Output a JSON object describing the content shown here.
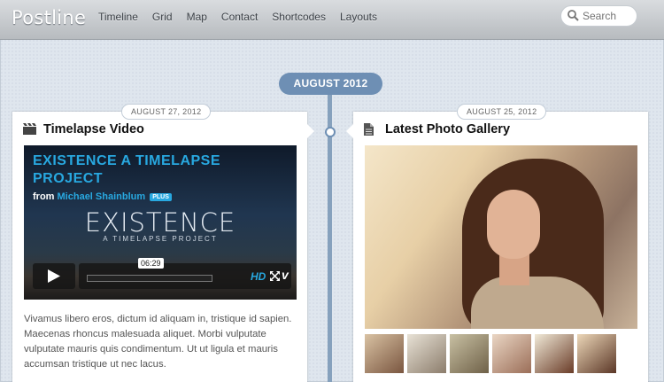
{
  "header": {
    "logo": "Postline",
    "menu": [
      "Timeline",
      "Grid",
      "Map",
      "Contact",
      "Shortcodes",
      "Layouts"
    ],
    "search_placeholder": "Search"
  },
  "timeline": {
    "month_label": "AUGUST 2012"
  },
  "posts": [
    {
      "date": "AUGUST 27, 2012",
      "title": "Timelapse Video",
      "icon": "film-icon",
      "video": {
        "title_line1": "EXISTENCE A TIMELAPSE",
        "title_line2": "PROJECT",
        "from": "from",
        "author": "Michael Shainblum",
        "badge": "PLUS",
        "big_title": "EXISTENCE",
        "subtitle": "A TIMELAPSE PROJECT",
        "time": "06:29",
        "hd": "HD",
        "vimeo": "v"
      },
      "excerpt": "Vivamus libero eros, dictum id aliquam in, tristique id sapien. Maecenas rhoncus malesuada aliquet. Morbi vulputate vulputate mauris quis condimentum. Ut ut ligula et mauris accumsan tristique ut nec lacus."
    },
    {
      "date": "AUGUST 25, 2012",
      "title": "Latest Photo Gallery",
      "icon": "document-icon",
      "thumbnail_count": 6
    }
  ],
  "colors": {
    "accent": "#6e8fb4",
    "link_blue": "#28a8e0"
  }
}
